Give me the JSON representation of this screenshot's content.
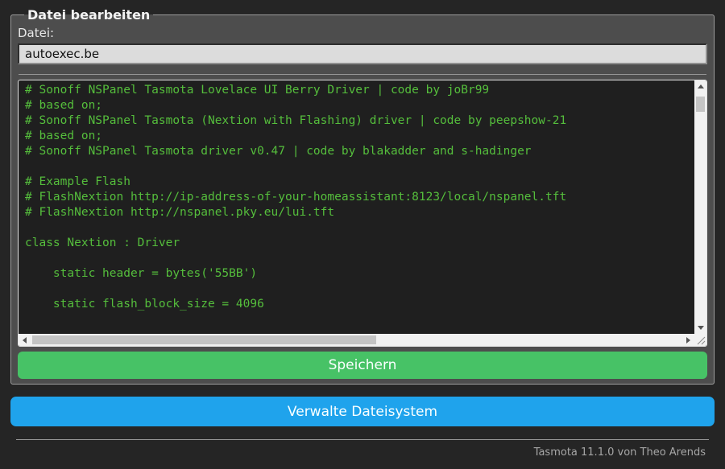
{
  "header": {
    "legend": "Datei bearbeiten"
  },
  "file_field": {
    "label": "Datei:",
    "value": "autoexec.be"
  },
  "editor": {
    "code": "# Sonoff NSPanel Tasmota Lovelace UI Berry Driver | code by joBr99\n# based on;\n# Sonoff NSPanel Tasmota (Nextion with Flashing) driver | code by peepshow-21\n# based on;\n# Sonoff NSPanel Tasmota driver v0.47 | code by blakadder and s-hadinger\n\n# Example Flash\n# FlashNextion http://ip-address-of-your-homeassistant:8123/local/nspanel.tft\n# FlashNextion http://nspanel.pky.eu/lui.tft\n\nclass Nextion : Driver\n\n    static header = bytes('55BB')\n\n    static flash_block_size = 4096"
  },
  "buttons": {
    "save": "Speichern",
    "manage_fs": "Verwalte Dateisystem"
  },
  "footer": {
    "text": "Tasmota 11.1.0 von Theo Arends"
  },
  "colors": {
    "page_bg": "#252525",
    "panel_bg": "#4d4d4d",
    "save_green": "#47c266",
    "manage_blue": "#1fa3ec",
    "code_green": "#55be3c",
    "code_bg": "#1f1f1f"
  }
}
